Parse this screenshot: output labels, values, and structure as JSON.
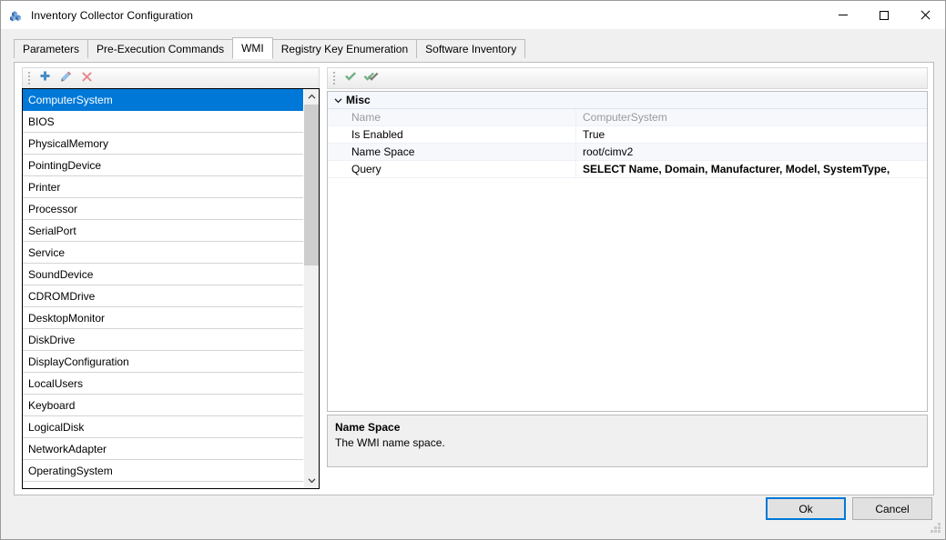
{
  "window": {
    "title": "Inventory Collector Configuration",
    "icon": "inventory-blocks-icon",
    "controls": {
      "minimize": "minimize-icon",
      "maximize": "maximize-icon",
      "close": "close-icon"
    }
  },
  "tabs": [
    {
      "label": "Parameters",
      "active": false
    },
    {
      "label": "Pre-Execution Commands",
      "active": false
    },
    {
      "label": "WMI",
      "active": true
    },
    {
      "label": "Registry Key Enumeration",
      "active": false
    },
    {
      "label": "Software Inventory",
      "active": false
    }
  ],
  "left_toolbar": {
    "buttons": [
      {
        "name": "add-button",
        "icon": "plus-icon",
        "color": "#4a8fc4"
      },
      {
        "name": "edit-button",
        "icon": "pencil-icon",
        "color": "#5a9bd5"
      },
      {
        "name": "delete-button",
        "icon": "delete-x-icon",
        "color": "#e8888c"
      }
    ]
  },
  "right_toolbar": {
    "buttons": [
      {
        "name": "enable-button",
        "icon": "check-icon",
        "color": "#72b185"
      },
      {
        "name": "enable-all-button",
        "icon": "double-check-icon",
        "color": "#72b185"
      }
    ]
  },
  "class_list": {
    "selected": "ComputerSystem",
    "items": [
      "ComputerSystem",
      "BIOS",
      "PhysicalMemory",
      "PointingDevice",
      "Printer",
      "Processor",
      "SerialPort",
      "Service",
      "SoundDevice",
      "CDROMDrive",
      "DesktopMonitor",
      "DiskDrive",
      "DisplayConfiguration",
      "LocalUsers",
      "Keyboard",
      "LogicalDisk",
      "NetworkAdapter",
      "OperatingSystem"
    ]
  },
  "property_grid": {
    "category": "Misc",
    "expanded": true,
    "rows": [
      {
        "name": "Name",
        "value": "ComputerSystem",
        "readonly": true,
        "bold": false
      },
      {
        "name": "Is Enabled",
        "value": "True",
        "readonly": false,
        "bold": false
      },
      {
        "name": "Name Space",
        "value": "root/cimv2",
        "readonly": false,
        "bold": false
      },
      {
        "name": "Query",
        "value": "SELECT Name, Domain, Manufacturer, Model, SystemType,",
        "readonly": false,
        "bold": true
      }
    ]
  },
  "description": {
    "title": "Name Space",
    "text": "The WMI name space."
  },
  "footer": {
    "ok_label": "Ok",
    "cancel_label": "Cancel"
  },
  "colors": {
    "accent": "#0078d7",
    "selection": "#0078d7",
    "window_bg": "#f0f0f0"
  }
}
